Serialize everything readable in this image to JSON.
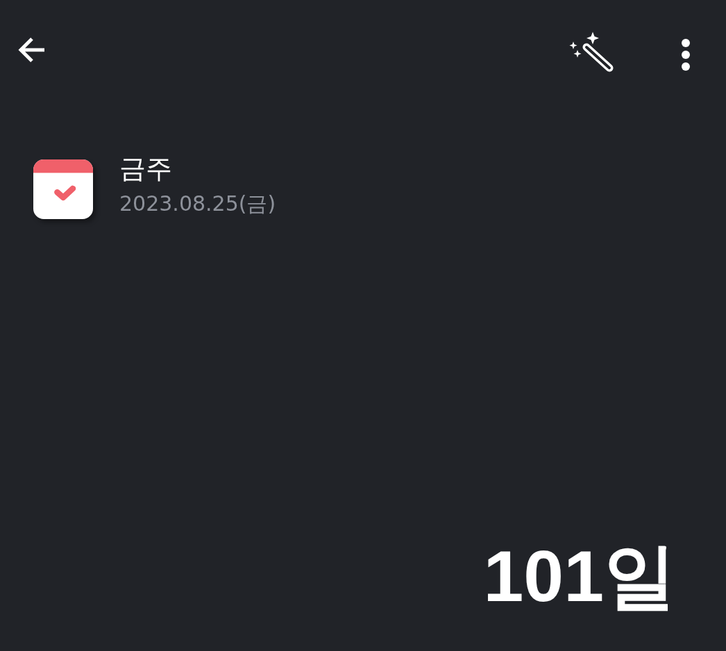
{
  "event": {
    "title": "금주",
    "date": "2023.08.25(금)"
  },
  "counter": "101일"
}
